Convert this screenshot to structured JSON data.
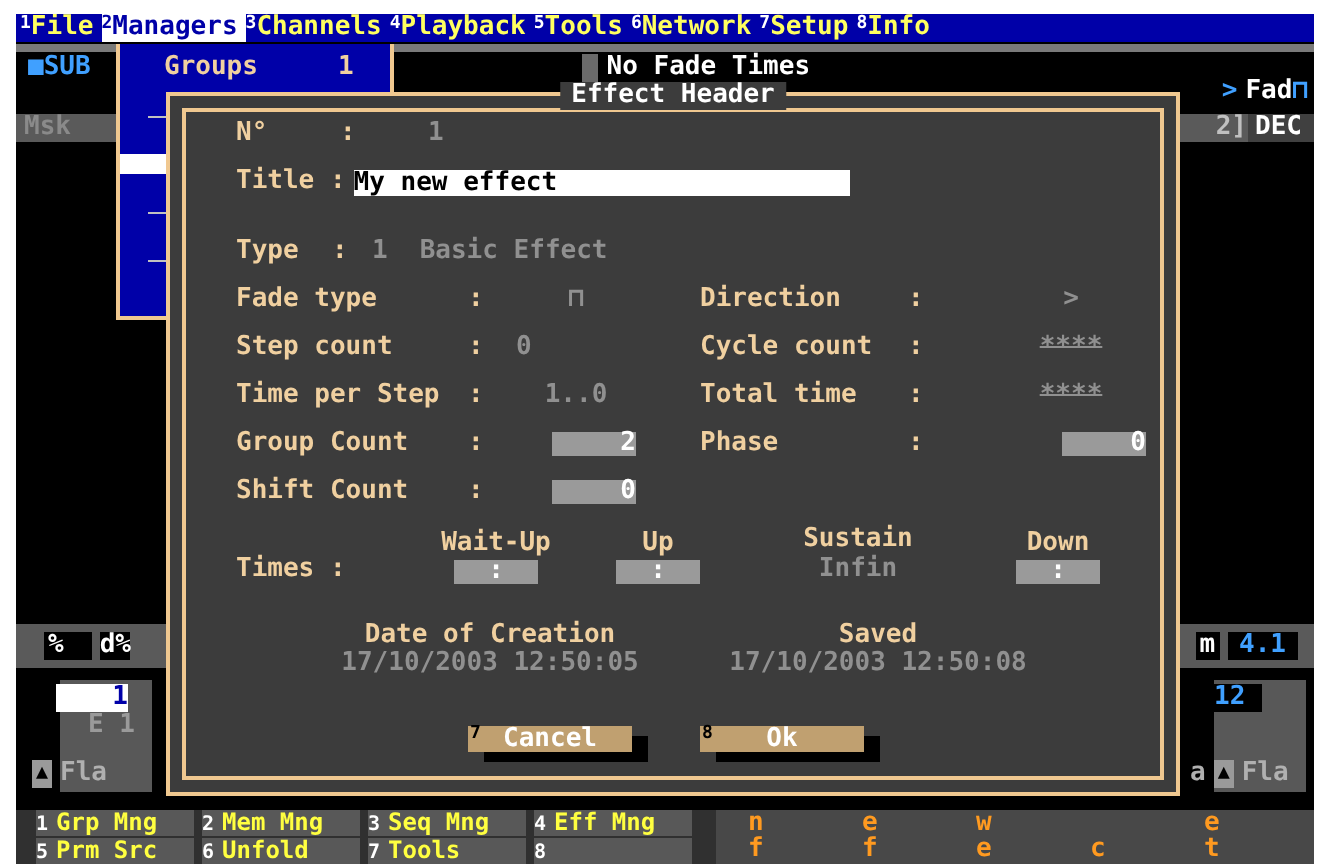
{
  "menu_bar": [
    {
      "key": "1",
      "label": "File",
      "selected": false
    },
    {
      "key": "2",
      "label": "Managers",
      "selected": true
    },
    {
      "key": "3",
      "label": "Channels",
      "selected": false
    },
    {
      "key": "4",
      "label": "Playback",
      "selected": false
    },
    {
      "key": "5",
      "label": "Tools",
      "selected": false
    },
    {
      "key": "6",
      "label": "Network",
      "selected": false
    },
    {
      "key": "7",
      "label": "Setup",
      "selected": false
    },
    {
      "key": "8",
      "label": "Info",
      "selected": false
    }
  ],
  "background": {
    "sub_label": "■SUB",
    "fade_status": "No Fade Times",
    "fade_mode": {
      "arrow": ">",
      "label": "Fad",
      "glyph": "⊓"
    },
    "mask_label": "Msk",
    "dec": {
      "index": "2]",
      "label": "DEC"
    },
    "level_labels": [
      "%",
      "d%"
    ],
    "right_level": {
      "label": "m",
      "value": "4.1"
    },
    "left_cell": {
      "number": "1",
      "name": "E 1",
      "flag": "▲",
      "footer": "Fla"
    },
    "right_cell": {
      "number": "12",
      "lead": "a",
      "flag": "▲",
      "footer": "Fla"
    }
  },
  "dropdown": {
    "items": [
      {
        "kind": "entry",
        "label": "Groups",
        "key": "1",
        "selected": false
      },
      {
        "kind": "stub",
        "selected": false
      },
      {
        "kind": "stub",
        "selected": true
      },
      {
        "kind": "stub",
        "selected": false
      },
      {
        "kind": "stub",
        "selected": false
      }
    ]
  },
  "dialog": {
    "title": "Effect Header",
    "separator": ":",
    "number": {
      "label": "N°",
      "value": "1"
    },
    "name": {
      "label": "Title",
      "value": "My new effect"
    },
    "type": {
      "label": "Type",
      "number": "1",
      "value": "Basic Effect"
    },
    "rows": [
      {
        "left": {
          "label": "Fade type",
          "kind": "centered",
          "value": "⊓"
        },
        "right": {
          "label": "Direction",
          "kind": "centered",
          "value": ">"
        }
      },
      {
        "left": {
          "label": "Step count",
          "kind": "text",
          "value": "0"
        },
        "right": {
          "label": "Cycle count",
          "kind": "dim",
          "value": "****"
        }
      },
      {
        "left": {
          "label": "Time per Step",
          "kind": "centered",
          "value": "1..0"
        },
        "right": {
          "label": "Total time",
          "kind": "dim",
          "value": "****"
        }
      },
      {
        "left": {
          "label": "Group Count",
          "kind": "box",
          "value": "2"
        },
        "right": {
          "label": "Phase",
          "kind": "box",
          "value": "0"
        }
      },
      {
        "left": {
          "label": "Shift Count",
          "kind": "box",
          "value": "0"
        }
      }
    ],
    "times": {
      "label": "Times",
      "columns": [
        {
          "heading": "Wait-Up",
          "kind": "box",
          "value": ":"
        },
        {
          "heading": "Up",
          "kind": "box",
          "value": ":"
        },
        {
          "heading": "Sustain",
          "kind": "text",
          "value": "Infin"
        },
        {
          "heading": "Down",
          "kind": "box",
          "value": ":"
        }
      ]
    },
    "dates": [
      {
        "heading": "Date of Creation",
        "value": "17/10/2003 12:50:05"
      },
      {
        "heading": "Saved",
        "value": "17/10/2003 12:50:08"
      }
    ],
    "buttons": [
      {
        "key": "7",
        "label": "Cancel"
      },
      {
        "key": "8",
        "label": "Ok"
      }
    ]
  },
  "function_keys": [
    [
      {
        "key": "1",
        "label": "Grp Mng"
      },
      {
        "key": "2",
        "label": "Mem Mng"
      },
      {
        "key": "3",
        "label": "Seq Mng"
      },
      {
        "key": "4",
        "label": "Eff Mng"
      }
    ],
    [
      {
        "key": "5",
        "label": "Prm Src"
      },
      {
        "key": "6",
        "label": "Unfold"
      },
      {
        "key": "7",
        "label": "Tools"
      },
      {
        "key": "8"
      }
    ]
  ],
  "letter_rows": [
    [
      {
        "kind": "letter",
        "text": "n"
      },
      {
        "kind": "letter",
        "text": "e"
      },
      {
        "kind": "letter",
        "text": "w"
      },
      {
        "kind": "gap"
      },
      {
        "kind": "letter",
        "text": "e"
      }
    ],
    [
      {
        "kind": "letter",
        "text": "f"
      },
      {
        "kind": "letter",
        "text": "f"
      },
      {
        "kind": "letter",
        "text": "e"
      },
      {
        "kind": "letter",
        "text": "c"
      },
      {
        "kind": "letter",
        "text": "t"
      }
    ]
  ]
}
